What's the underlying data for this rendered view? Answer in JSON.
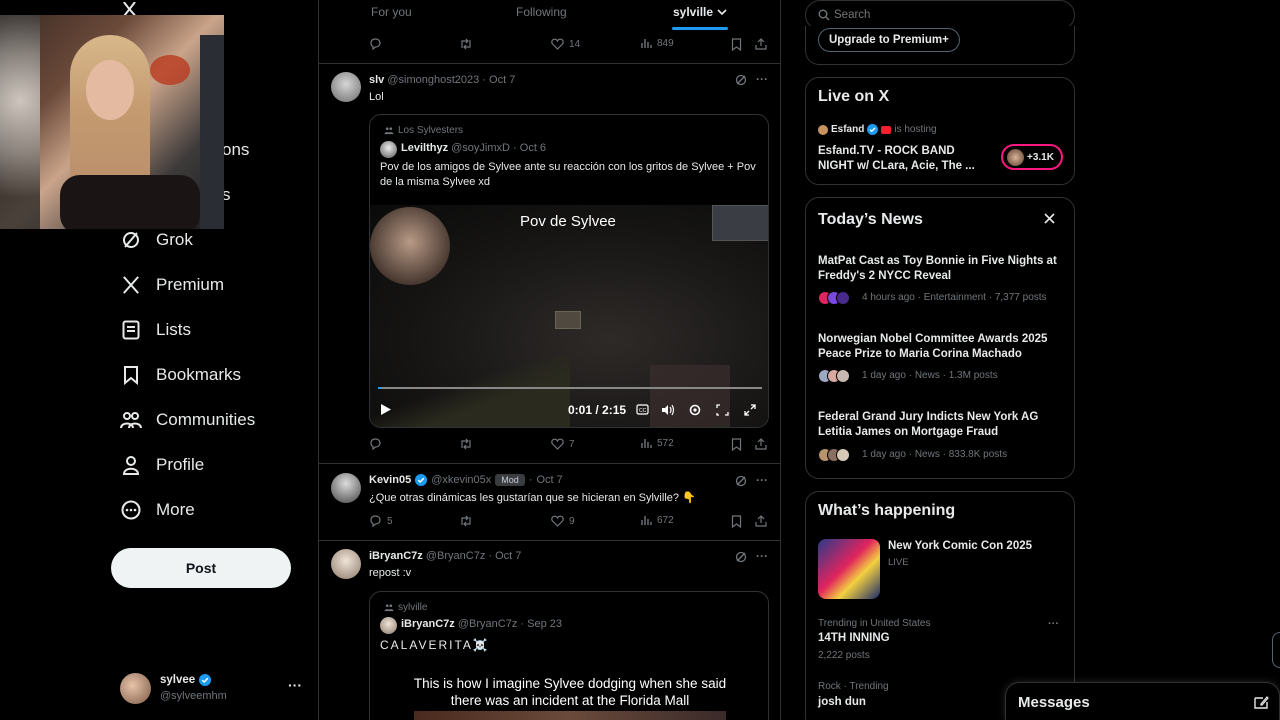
{
  "sidebar": {
    "nav": [
      {
        "label": "ons",
        "icon": "notifications-icon"
      },
      {
        "label": "s",
        "icon": "messages-icon"
      },
      {
        "label": "Grok",
        "icon": "grok-icon"
      },
      {
        "label": "Premium",
        "icon": "x-logo-icon"
      },
      {
        "label": "Lists",
        "icon": "lists-icon"
      },
      {
        "label": "Bookmarks",
        "icon": "bookmark-icon"
      },
      {
        "label": "Communities",
        "icon": "communities-icon"
      },
      {
        "label": "Profile",
        "icon": "profile-icon"
      },
      {
        "label": "More",
        "icon": "more-circle-icon"
      }
    ],
    "post_label": "Post",
    "account": {
      "name": "sylvee",
      "handle": "@sylveemhm",
      "more": "···"
    }
  },
  "feed": {
    "tabs": [
      "For you",
      "Following",
      "sylville"
    ],
    "active_tab": "sylville",
    "top_actions": {
      "reply": "",
      "repost": "",
      "like": "14",
      "views": "849"
    },
    "tweets": [
      {
        "name": "slv",
        "handle": "@simonghost2023",
        "date": "Oct 7",
        "text": "Lol",
        "quote": {
          "community": "Los Sylvesters",
          "name": "Levilthyz",
          "handle": "@soyJimxD",
          "date": "Oct 6",
          "text": "Pov de los amigos de Sylvee ante su reacción con los gritos de Sylvee + Pov de la misma Sylvee xd",
          "video": {
            "caption": "Pov de Sylvee",
            "time": "0:01 / 2:15",
            "progress": 0.01
          }
        },
        "actions": {
          "reply": "",
          "repost": "",
          "like": "7",
          "views": "572"
        }
      },
      {
        "name": "Kevin05",
        "handle": "@xkevin05x",
        "badge": "Mod",
        "date": "Oct 7",
        "text": "¿Que otras dinámicas les gustarían que se hicieran en Sylville? 👇",
        "actions": {
          "reply": "5",
          "repost": "",
          "like": "9",
          "views": "672"
        }
      },
      {
        "name": "iBryanC7z",
        "handle": "@BryanC7z",
        "date": "Oct 7",
        "text": "repost :v",
        "quote": {
          "community": "sylville",
          "name": "iBryanC7z",
          "handle": "@BryanC7z",
          "date": "Sep 23",
          "text": "CALAVERITA☠️",
          "video_caption": "This is how I imagine Sylvee dodging when she said there was an incident at the Florida Mall"
        }
      }
    ]
  },
  "right": {
    "search_placeholder": "Search",
    "premium_label": "Upgrade to Premium+",
    "live": {
      "title": "Live on X",
      "host": "Esfand",
      "hosting": "is hosting",
      "stream": "Esfand.TV - ROCK BAND NIGHT w/ CLara, Acie, The ...",
      "count": "+3.1K"
    },
    "news": {
      "title": "Today’s News",
      "items": [
        {
          "headline": "MatPat Cast as Toy Bonnie in Five Nights at Freddy's 2 NYCC Reveal",
          "meta": "4 hours ago · Entertainment · 7,377 posts"
        },
        {
          "headline": "Norwegian Nobel Committee Awards 2025 Peace Prize to Maria Corina Machado",
          "meta": "1 day ago · News · 1.3M posts"
        },
        {
          "headline": "Federal Grand Jury Indicts New York AG Letitia James on Mortgage Fraud",
          "meta": "1 day ago · News · 833.8K posts"
        }
      ]
    },
    "happening": {
      "title": "What’s happening",
      "event": {
        "title": "New York Comic Con 2025",
        "status": "LIVE"
      },
      "trends": [
        {
          "context": "Trending in United States",
          "name": "14TH INNING",
          "posts": "2,222 posts"
        },
        {
          "context": "Rock · Trending",
          "name": "josh dun",
          "posts": ""
        }
      ]
    },
    "messages_label": "Messages"
  },
  "colors": {
    "accent": "#1d9bf0",
    "background": "#000000",
    "border": "#2f3336",
    "muted": "#71767b",
    "live_pink": "#f91880"
  }
}
